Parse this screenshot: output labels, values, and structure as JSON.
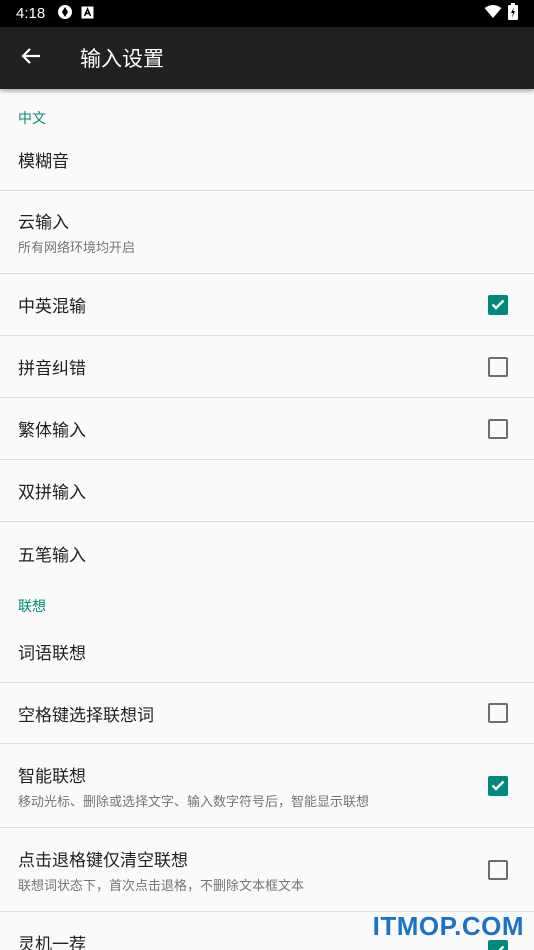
{
  "status_bar": {
    "time": "4:18"
  },
  "app_bar": {
    "title": "输入设置",
    "back_icon": "arrow-left-icon"
  },
  "sections": {
    "chinese": {
      "header": "中文",
      "items": {
        "fuzzy": {
          "title": "模糊音"
        },
        "cloud": {
          "title": "云输入",
          "summary": "所有网络环境均开启"
        },
        "mixed": {
          "title": "中英混输",
          "checked": true
        },
        "pinyin_correct": {
          "title": "拼音纠错",
          "checked": false
        },
        "traditional": {
          "title": "繁体输入",
          "checked": false
        },
        "shuangpin": {
          "title": "双拼输入"
        },
        "wubi": {
          "title": "五笔输入"
        }
      }
    },
    "association": {
      "header": "联想",
      "items": {
        "word_assoc": {
          "title": "词语联想"
        },
        "space_select": {
          "title": "空格键选择联想词",
          "checked": false
        },
        "smart_assoc": {
          "title": "智能联想",
          "summary": "移动光标、删除或选择文字、输入数字符号后，智能显示联想",
          "checked": true
        },
        "backspace_clear": {
          "title": "点击退格键仅清空联想",
          "summary": "联想词状态下，首次点击退格，不删除文本框文本",
          "checked": false
        },
        "lingji": {
          "title": "灵机一荐",
          "checked": true
        }
      }
    }
  },
  "colors": {
    "accent": "#00897b",
    "app_bar": "#212121",
    "status_bar": "#000000",
    "background": "#fafafa"
  },
  "watermark": "ITMOP.COM"
}
